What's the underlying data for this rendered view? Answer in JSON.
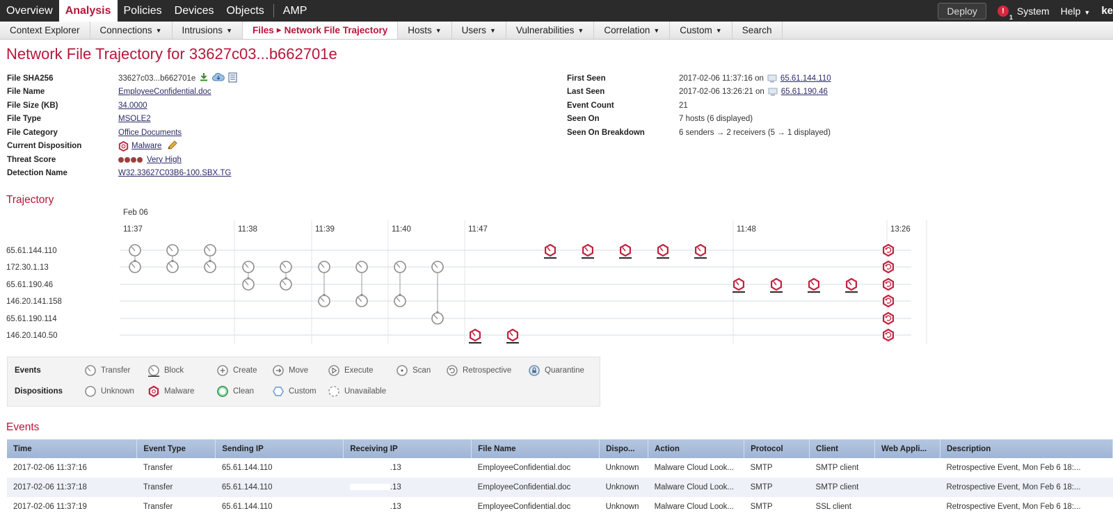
{
  "topnav": {
    "items": [
      "Overview",
      "Analysis",
      "Policies",
      "Devices",
      "Objects",
      "AMP"
    ],
    "active": "Analysis",
    "deploy": "Deploy",
    "alert_count": "1",
    "system": "System",
    "help": "Help",
    "user": "ke"
  },
  "subnav": {
    "items": [
      {
        "label": "Context Explorer",
        "caret": false
      },
      {
        "label": "Connections",
        "caret": true
      },
      {
        "label": "Intrusions",
        "caret": true
      },
      {
        "label": "Files",
        "sub": "Network File Trajectory",
        "active": true
      },
      {
        "label": "Hosts",
        "caret": true
      },
      {
        "label": "Users",
        "caret": true
      },
      {
        "label": "Vulnerabilities",
        "caret": true
      },
      {
        "label": "Correlation",
        "caret": true
      },
      {
        "label": "Custom",
        "caret": true
      },
      {
        "label": "Search",
        "caret": false
      }
    ]
  },
  "page_title": "Network File Trajectory for 33627c03...b662701e",
  "summary_left": {
    "sha_label": "File SHA256",
    "sha_value": "33627c03...b662701e",
    "name_label": "File Name",
    "name_value": "EmployeeConfidential.doc",
    "size_label": "File Size (KB)",
    "size_value": "34.0000",
    "type_label": "File Type",
    "type_value": "MSOLE2",
    "category_label": "File Category",
    "category_value": "Office Documents",
    "disposition_label": "Current Disposition",
    "disposition_value": "Malware",
    "threat_label": "Threat Score",
    "threat_value": "Very High",
    "threat_level": 4,
    "detection_label": "Detection Name",
    "detection_value": "W32.33627C03B6-100.SBX.TG"
  },
  "summary_right": {
    "first_label": "First Seen",
    "first_value": "2017-02-06 11:37:16 on",
    "first_host": "65.61.144.110",
    "last_label": "Last Seen",
    "last_value": "2017-02-06 13:26:21 on",
    "last_host": "65.61.190.46",
    "count_label": "Event Count",
    "count_value": "21",
    "seenon_label": "Seen On",
    "seenon_value": "7 hosts (6 displayed)",
    "breakdown_label": "Seen On Breakdown",
    "breakdown_value": "6 senders → 2 receivers (5 → 1 displayed)"
  },
  "trajectory": {
    "title": "Trajectory",
    "date": "Feb 06",
    "times": [
      "11:37",
      "11:38",
      "11:39",
      "11:40",
      "11:47",
      "11:48",
      "13:26"
    ],
    "hosts": [
      "65.61.144.110",
      "172.30.1.13",
      "65.61.190.46",
      "146.20.141.158",
      "65.61.190.114",
      "146.20.140.50"
    ]
  },
  "legend": {
    "events_label": "Events",
    "dispositions_label": "Dispositions",
    "events": [
      "Transfer",
      "Block",
      "Create",
      "Move",
      "Execute",
      "Scan",
      "Retrospective",
      "Quarantine"
    ],
    "dispositions": [
      "Unknown",
      "Malware",
      "Clean",
      "Custom",
      "Unavailable"
    ]
  },
  "events": {
    "title": "Events",
    "columns": [
      "Time",
      "Event Type",
      "Sending IP",
      "Receiving IP",
      "File Name",
      "Dispo...",
      "Action",
      "Protocol",
      "Client",
      "Web Appli...",
      "Description"
    ],
    "rows": [
      [
        "2017-02-06 11:37:16",
        "Transfer",
        "65.61.144.110",
        ".13",
        "EmployeeConfidential.doc",
        "Unknown",
        "Malware Cloud Look...",
        "SMTP",
        "SMTP client",
        "",
        "Retrospective Event, Mon Feb 6 18:..."
      ],
      [
        "2017-02-06 11:37:18",
        "Transfer",
        "65.61.144.110",
        ".13",
        "EmployeeConfidential.doc",
        "Unknown",
        "Malware Cloud Look...",
        "SMTP",
        "SMTP client",
        "",
        "Retrospective Event, Mon Feb 6 18:..."
      ],
      [
        "2017-02-06 11:37:19",
        "Transfer",
        "65.61.144.110",
        ".13",
        "EmployeeConfidential.doc",
        "Unknown",
        "Malware Cloud Look...",
        "SMTP",
        "SSL client",
        "",
        "Retrospective Event, Mon Feb 6 18:..."
      ]
    ]
  }
}
